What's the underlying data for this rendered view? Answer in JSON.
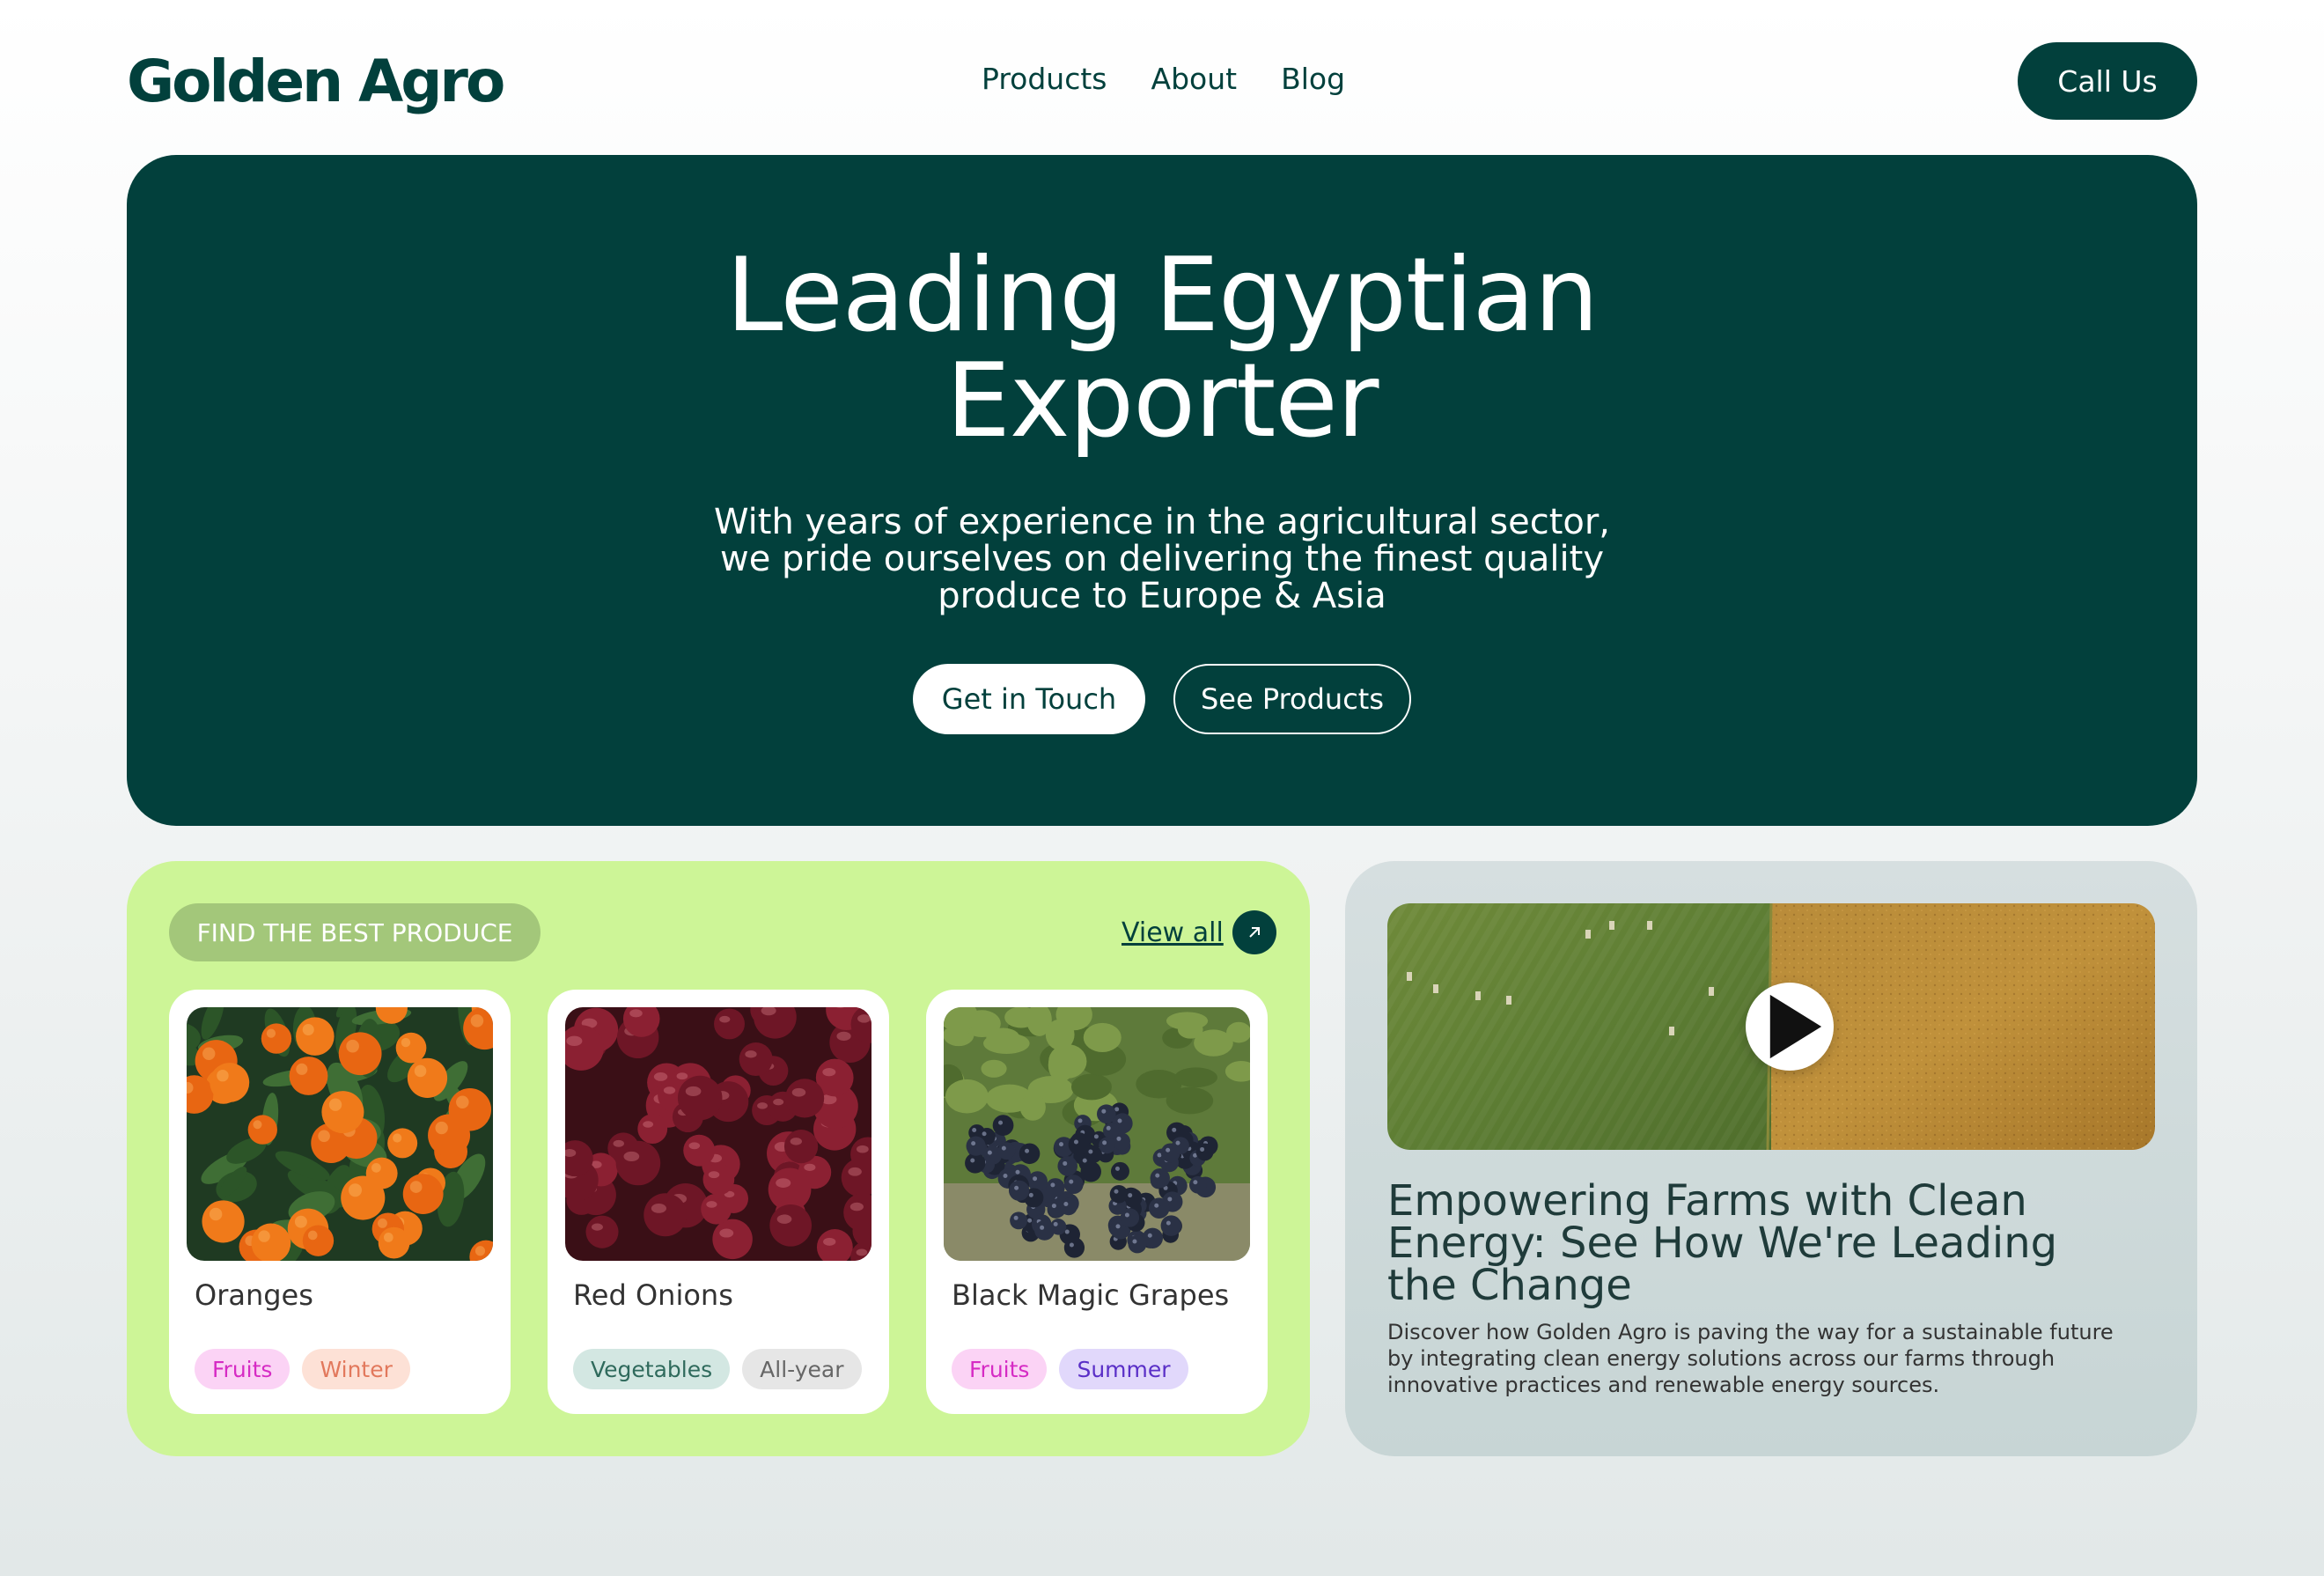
{
  "header": {
    "logo": "Golden Agro",
    "nav": [
      "Products",
      "About",
      "Blog"
    ],
    "cta": "Call Us"
  },
  "hero": {
    "title_line1": "Leading Egyptian",
    "title_line2": "Exporter",
    "subtitle": "With years of experience in the agricultural sector, we pride ourselves on delivering the finest quality produce to Europe & Asia",
    "primary_button": "Get in Touch",
    "secondary_button": "See Products"
  },
  "produce": {
    "badge": "FIND THE BEST PRODUCE",
    "view_all": "View all",
    "items": [
      {
        "name": "Oranges",
        "image": "oranges-photo",
        "tags": [
          {
            "label": "Fruits",
            "bg": "#fbd3f5",
            "color": "#d62bc4"
          },
          {
            "label": "Winter",
            "bg": "#fde1d6",
            "color": "#e2785c"
          }
        ]
      },
      {
        "name": "Red Onions",
        "image": "red-onions-photo",
        "tags": [
          {
            "label": "Vegetables",
            "bg": "#d3e7e2",
            "color": "#2f6a5c"
          },
          {
            "label": "All-year",
            "bg": "#e6e6e6",
            "color": "#666666"
          }
        ]
      },
      {
        "name": "Black Magic Grapes",
        "image": "grapes-photo",
        "tags": [
          {
            "label": "Fruits",
            "bg": "#fbd3f5",
            "color": "#d62bc4"
          },
          {
            "label": "Summer",
            "bg": "#e1d8fb",
            "color": "#5a2fc7"
          }
        ]
      }
    ]
  },
  "blog": {
    "image": "farm-aerial-video",
    "title": "Empowering Farms with Clean Energy: See How We're Leading the Change",
    "description": "Discover how Golden Agro is paving the way for a sustainable future by integrating clean energy solutions across our farms through innovative practices and renewable energy sources."
  },
  "colors": {
    "brand": "#02403c",
    "produce_panel": "#cdf597",
    "blog_panel": "#c7d5d5"
  }
}
